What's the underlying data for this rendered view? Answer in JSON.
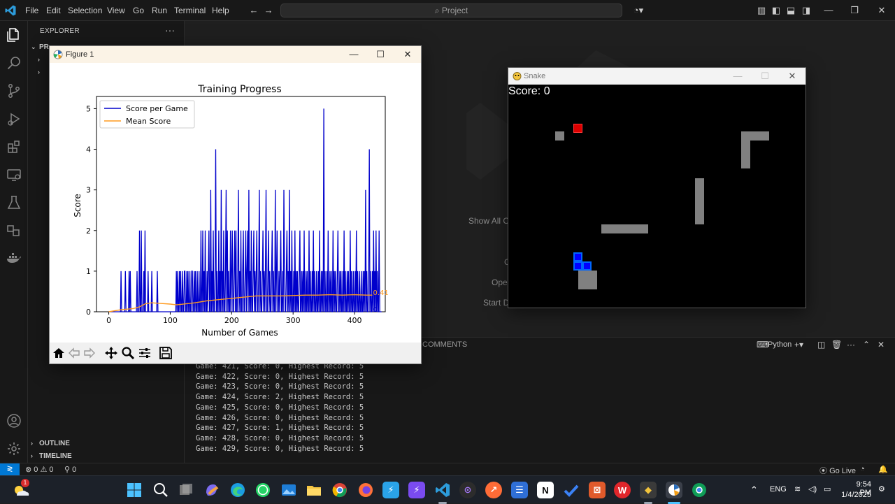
{
  "vscode": {
    "menu": [
      "File",
      "Edit",
      "Selection",
      "View",
      "Go",
      "Run",
      "Terminal",
      "Help"
    ],
    "search_placeholder": "Project",
    "sidebar": {
      "title": "EXPLORER",
      "more": "···",
      "project_label": "PR",
      "sections": [
        {
          "label": "OUTLINE"
        },
        {
          "label": "TIMELINE"
        }
      ]
    },
    "welcome": {
      "show_all": "Show All C",
      "line2": "C",
      "open": "Ope",
      "start": "Start D"
    },
    "panel": {
      "tab": "COMMENTS",
      "terminal_label": "Python",
      "lines": [
        "Game: 421, Score: 0, Highest Record: 5",
        "Game: 422, Score: 0, Highest Record: 5",
        "Game: 423, Score: 0, Highest Record: 5",
        "Game: 424, Score: 2, Highest Record: 5",
        "Game: 425, Score: 0, Highest Record: 5",
        "Game: 426, Score: 0, Highest Record: 5",
        "Game: 427, Score: 1, Highest Record: 5",
        "Game: 428, Score: 0, Highest Record: 5",
        "Game: 429, Score: 0, Highest Record: 5"
      ]
    },
    "statusbar": {
      "problems": "0 ⚠ 0",
      "ports": "0",
      "go_live": "Go Live"
    }
  },
  "figure": {
    "window_title": "Figure 1"
  },
  "chart_data": {
    "type": "line",
    "title": "Training Progress",
    "xlabel": "Number of Games",
    "ylabel": "Score",
    "xlim": [
      -20,
      450
    ],
    "ylim": [
      0,
      5.3
    ],
    "xticks": [
      0,
      100,
      200,
      300,
      400
    ],
    "yticks": [
      0,
      1,
      2,
      3,
      4,
      5
    ],
    "legend_position": "top-left",
    "series": [
      {
        "name": "Score per Game",
        "color": "#0000cc",
        "values": [
          0,
          0,
          0,
          0,
          0,
          0,
          0,
          0,
          0,
          0,
          0,
          0,
          0,
          0,
          0,
          0,
          0,
          0,
          0,
          0,
          1,
          0,
          0,
          0,
          0,
          0,
          0,
          1,
          0,
          0,
          0,
          0,
          0,
          1,
          0,
          1,
          0,
          0,
          0,
          0,
          0,
          0,
          0,
          0,
          0,
          0,
          1,
          0,
          0,
          0,
          2,
          0,
          0,
          2,
          0,
          0,
          0,
          1,
          0,
          2,
          0,
          0,
          0,
          0,
          1,
          0,
          0,
          0,
          0,
          0,
          1,
          0,
          0,
          0,
          0,
          0,
          0,
          0,
          0,
          1,
          0,
          0,
          0,
          0,
          0,
          0,
          0,
          0,
          0,
          0,
          0,
          0,
          0,
          0,
          0,
          0,
          0,
          0,
          0,
          0,
          0,
          0,
          0,
          0,
          0,
          0,
          0,
          0,
          0,
          0,
          1,
          0,
          1,
          0,
          0,
          1,
          0,
          1,
          0,
          0,
          1,
          0,
          0,
          1,
          1,
          0,
          0,
          1,
          0,
          1,
          0,
          0,
          1,
          0,
          0,
          1,
          1,
          0,
          0,
          1,
          0,
          1,
          0,
          0,
          1,
          0,
          0,
          1,
          0,
          0,
          2,
          0,
          0,
          2,
          0,
          1,
          0,
          2,
          0,
          0,
          1,
          0,
          1,
          2,
          0,
          0,
          3,
          0,
          1,
          0,
          2,
          0,
          0,
          1,
          4,
          0,
          1,
          0,
          0,
          2,
          0,
          1,
          0,
          3,
          0,
          1,
          0,
          2,
          0,
          0,
          1,
          3,
          0,
          2,
          0,
          1,
          0,
          0,
          2,
          0,
          1,
          2,
          0,
          0,
          1,
          2,
          0,
          2,
          0,
          0,
          1,
          3,
          0,
          1,
          0,
          2,
          0,
          0,
          1,
          2,
          0,
          0,
          1,
          2,
          0,
          1,
          2,
          0,
          3,
          0,
          1,
          0,
          2,
          0,
          0,
          1,
          2,
          0,
          1,
          0,
          1,
          2,
          0,
          0,
          1,
          3,
          0,
          1,
          0,
          0,
          1,
          2,
          0,
          1,
          0,
          1,
          3,
          0,
          0,
          1,
          2,
          0,
          1,
          0,
          0,
          1,
          2,
          0,
          1,
          0,
          0,
          3,
          0,
          1,
          2,
          0,
          0,
          1,
          0,
          1,
          2,
          0,
          0,
          1,
          0,
          3,
          1,
          0,
          0,
          1,
          2,
          0,
          1,
          0,
          3,
          0,
          1,
          0,
          2,
          0,
          0,
          1,
          0,
          2,
          0,
          1,
          0,
          1,
          0,
          0,
          1,
          2,
          0,
          0,
          1,
          0,
          1,
          0,
          2,
          0,
          0,
          1,
          0,
          1,
          0,
          0,
          2,
          0,
          1,
          0,
          0,
          1,
          0,
          2,
          0,
          1,
          0,
          0,
          1,
          0,
          0,
          1,
          0,
          2,
          0,
          0,
          1,
          0,
          1,
          0,
          5,
          0,
          1,
          0,
          0,
          1,
          0,
          2,
          0,
          0,
          1,
          0,
          1,
          0,
          0,
          2,
          0,
          1,
          0,
          1,
          0,
          0,
          1,
          2,
          0,
          0,
          1,
          0,
          1,
          0,
          0,
          1,
          0,
          2,
          0,
          1,
          0,
          0,
          1,
          0,
          1,
          0,
          0,
          2,
          0,
          1,
          0,
          0,
          1,
          0,
          0,
          1,
          0,
          2,
          0,
          1,
          0,
          0,
          1,
          0,
          0,
          1,
          0,
          0,
          1,
          0,
          1,
          0,
          3,
          0,
          1,
          0,
          0,
          1,
          4,
          0,
          1,
          0,
          0,
          1,
          0,
          2,
          0,
          1,
          0,
          2,
          0,
          1,
          0,
          0,
          2,
          0,
          0,
          0,
          0
        ]
      },
      {
        "name": "Mean Score",
        "color": "#ff9a1e",
        "values": [
          [
            0,
            0
          ],
          [
            20,
            0.05
          ],
          [
            40,
            0.08
          ],
          [
            50,
            0.12
          ],
          [
            60,
            0.2
          ],
          [
            70,
            0.22
          ],
          [
            80,
            0.21
          ],
          [
            100,
            0.19
          ],
          [
            110,
            0.17
          ],
          [
            140,
            0.22
          ],
          [
            160,
            0.27
          ],
          [
            180,
            0.3
          ],
          [
            200,
            0.33
          ],
          [
            220,
            0.36
          ],
          [
            240,
            0.39
          ],
          [
            260,
            0.39
          ],
          [
            280,
            0.39
          ],
          [
            300,
            0.4
          ],
          [
            320,
            0.41
          ],
          [
            340,
            0.41
          ],
          [
            360,
            0.42
          ],
          [
            380,
            0.41
          ],
          [
            400,
            0.42
          ],
          [
            420,
            0.41
          ],
          [
            429,
            0.41
          ]
        ]
      }
    ],
    "annotations": [
      {
        "text": "0.41",
        "x": 429,
        "y": 0.41,
        "color": "#ff9a1e"
      },
      {
        "text": "0",
        "x": 429,
        "y": 0,
        "color": "#0000cc"
      }
    ]
  },
  "snake": {
    "window_title": "Snake",
    "score_text": "Score: 0",
    "colors": {
      "food": "#dd0000",
      "snake_head": "#0000ff",
      "snake_body": "#0055ff",
      "obstacle": "#808080"
    }
  },
  "taskbar": {
    "lang": "ENG",
    "time": "9:54 PM",
    "date": "1/4/2025",
    "weather_badge": "1"
  }
}
